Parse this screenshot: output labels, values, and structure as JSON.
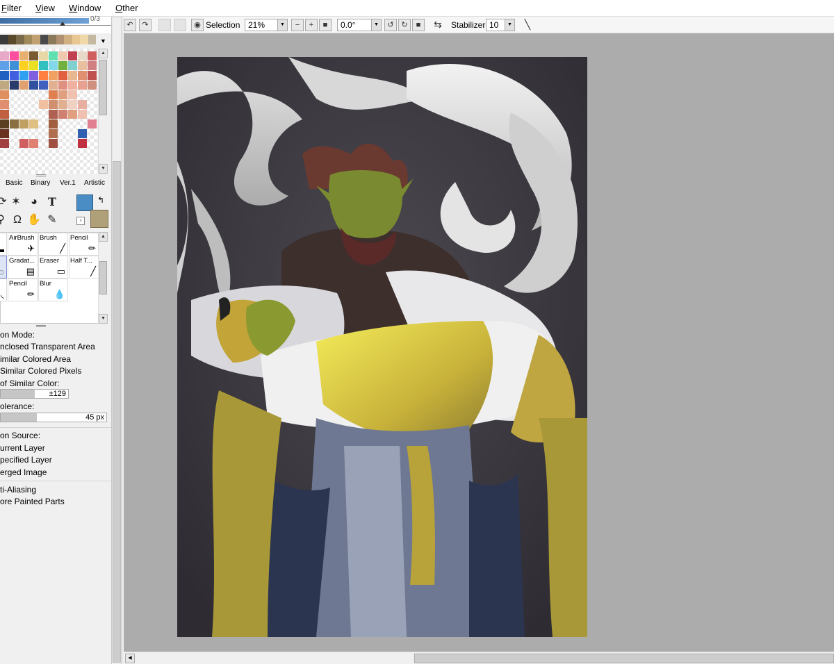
{
  "menu": {
    "filter": {
      "underline": "F",
      "rest": "ilter"
    },
    "view": {
      "underline": "V",
      "rest": "iew"
    },
    "window": {
      "underline": "W",
      "rest": "indow"
    },
    "other": {
      "underline": "O",
      "rest": "ther"
    }
  },
  "color_panel": {
    "value_readout": "0/3",
    "recent_colors": [
      "#3a3a3a",
      "#5a4a2a",
      "#7a6a4a",
      "#a08a5a",
      "#c0a070",
      "#4a4a4a",
      "#8a7a5a",
      "#b09070",
      "#d0b080",
      "#e8c890",
      "#f0d8a8",
      "#c4b8a0"
    ]
  },
  "brush_tabs": [
    "Basic",
    "Binary",
    "Ver.1",
    "Artistic"
  ],
  "brushes": [
    {
      "label": "",
      "icon": "pen-icon"
    },
    {
      "label": "AirBrush",
      "icon": "airbrush-icon"
    },
    {
      "label": "Brush",
      "icon": "brush-icon"
    },
    {
      "label": "Pencil",
      "icon": "pencil-icon"
    },
    {
      "label": "",
      "icon": "water-icon"
    },
    {
      "label": "Gradat...",
      "icon": "gradation-icon"
    },
    {
      "label": "Eraser",
      "icon": "eraser-icon"
    },
    {
      "label": "Half T...",
      "icon": "halftone-icon"
    },
    {
      "label": "e",
      "icon": "marker-icon"
    },
    {
      "label": "Pencil",
      "icon": "pencil-icon"
    },
    {
      "label": "Blur",
      "icon": "blur-icon"
    }
  ],
  "tool_settings": {
    "mode_label": "on Mode:",
    "opt1": "nclosed Transparent Area",
    "opt2": "imilar Colored Area",
    "opt3": " Similar Colored Pixels",
    "similar_label": " of Similar Color:",
    "similar_value": "±129",
    "similar_fraction": 0.5,
    "tolerance_label": "olerance:",
    "tolerance_value": "45 px",
    "tolerance_fraction": 0.34,
    "source_label": "on Source:",
    "src1": "urrent Layer",
    "src2": "pecified Layer",
    "src3": "erged Image",
    "aa": "ti-Aliasing",
    "ignore": "ore Painted Parts"
  },
  "toolbar": {
    "selection_label": "Selection",
    "zoom": "21%",
    "angle": "0.0°",
    "stabilizer_label": "Stabilizer",
    "stabilizer_value": "10"
  }
}
